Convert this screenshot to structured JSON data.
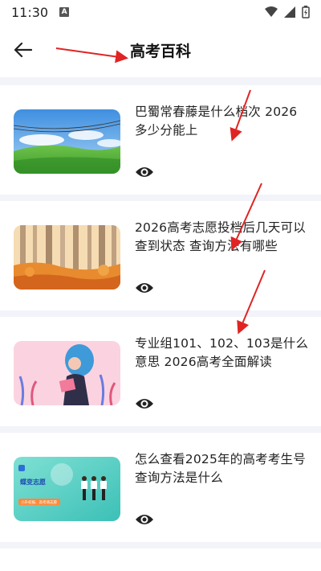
{
  "status": {
    "time": "11:30",
    "notification_badge": "A"
  },
  "header": {
    "title": "高考百科",
    "back_icon": "arrow-left-icon"
  },
  "articles": [
    {
      "title": "巴蜀常春藤是什么档次 2026多少分能上",
      "view_icon": "eye-icon",
      "thumbnail": "landscape-illustration"
    },
    {
      "title": "2026高考志愿投档后几天可以查到状态 查询方法有哪些",
      "view_icon": "eye-icon",
      "thumbnail": "autumn-forest-illustration"
    },
    {
      "title": "专业组101、102、103是什么意思 2026高考全面解读",
      "view_icon": "eye-icon",
      "thumbnail": "girl-reading-illustration"
    },
    {
      "title": "怎么查看2025年的高考考生号查询方法是什么",
      "view_icon": "eye-icon",
      "thumbnail": "app-banner",
      "banner": {
        "brand": "蝶变志愿",
        "tagline": "小升初报、高考填志愿"
      }
    }
  ],
  "colors": {
    "accent": "#e02424",
    "background": "#f2f4f9"
  }
}
